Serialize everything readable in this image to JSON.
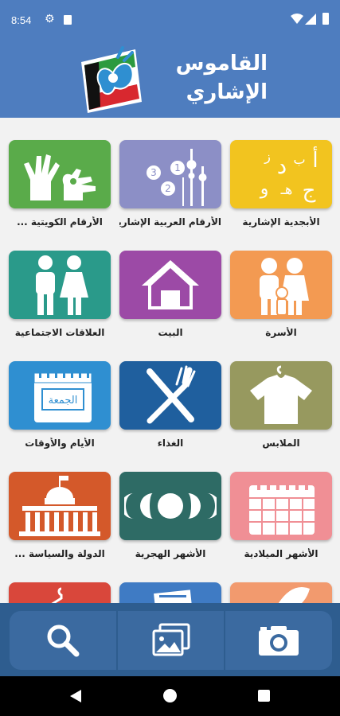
{
  "status_bar": {
    "time": "8:54",
    "icons": [
      "gear-icon",
      "sd-card-icon",
      "wifi-icon",
      "signal-icon",
      "battery-icon"
    ]
  },
  "header": {
    "title_line1": "القاموس",
    "title_line2": "الإشاري",
    "logo": "sign-language-kuwait-logo"
  },
  "colors": {
    "header_blue": "#4e7dbf",
    "toolbar_blue": "#3b6aa0",
    "background": "#f2f2f2"
  },
  "tiles": [
    {
      "label": "الأبجدية الإشارية",
      "color": "#f2c41f",
      "icon": "arabic-letters-icon"
    },
    {
      "label": "الأرقام العربية الإشارية",
      "color": "#8c8fc6",
      "icon": "numbers-towers-icon"
    },
    {
      "label": "الأرقام الكويتية ...",
      "color": "#5aab4a",
      "icon": "hand-signs-icon"
    },
    {
      "label": "الأسرة",
      "color": "#f39a52",
      "icon": "family-icon"
    },
    {
      "label": "البيت",
      "color": "#9c4aa6",
      "icon": "house-icon"
    },
    {
      "label": "العلاقات الاجتماعية",
      "color": "#2a9a8a",
      "icon": "couple-icon"
    },
    {
      "label": "الملابس",
      "color": "#97995f",
      "icon": "shirt-icon"
    },
    {
      "label": "الغذاء",
      "color": "#1f5f9e",
      "icon": "fork-knife-icon"
    },
    {
      "label": "الأيام والأوقات",
      "color": "#2f8fd1",
      "icon": "calendar-day-icon"
    },
    {
      "label": "الأشهر الميلادية",
      "color": "#f08f95",
      "icon": "calendar-grid-icon"
    },
    {
      "label": "الأشهر الهجرية",
      "color": "#2e6b65",
      "icon": "moon-phases-icon"
    },
    {
      "label": "الدولة والسياسة ...",
      "color": "#d4592a",
      "icon": "parliament-icon"
    }
  ],
  "calendar_word": "الجمعة",
  "partial_tiles": [
    {
      "color": "#f29a6e"
    },
    {
      "color": "#3f7bc4"
    },
    {
      "color": "#d9473b"
    }
  ],
  "toolbar": {
    "buttons": [
      "search-icon",
      "gallery-icon",
      "camera-icon"
    ]
  },
  "nav": {
    "buttons": [
      "back-icon",
      "home-icon",
      "recent-apps-icon"
    ]
  }
}
